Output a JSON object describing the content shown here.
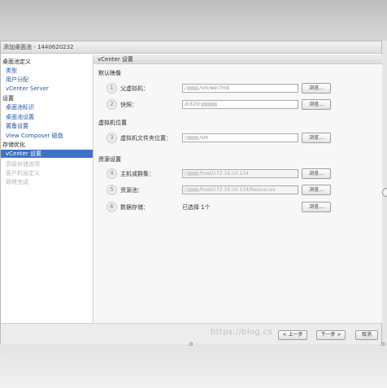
{
  "dialog": {
    "title": "添加桌面池 - 1440620232"
  },
  "sidebar": {
    "items": [
      {
        "label": "桌面池定义",
        "kind": "group"
      },
      {
        "label": "类型",
        "kind": "link"
      },
      {
        "label": "用户分配",
        "kind": "link"
      },
      {
        "label": "vCenter Server",
        "kind": "link"
      },
      {
        "label": "设置",
        "kind": "group"
      },
      {
        "label": "桌面池标识",
        "kind": "link"
      },
      {
        "label": "桌面池设置",
        "kind": "link"
      },
      {
        "label": "置备设置",
        "kind": "link"
      },
      {
        "label": "View Composer 磁盘",
        "kind": "link"
      },
      {
        "label": "存储优化",
        "kind": "group"
      },
      {
        "label": "vCenter 设置",
        "kind": "active"
      },
      {
        "label": "高级存储选项",
        "kind": "disabled"
      },
      {
        "label": "客户机自定义",
        "kind": "disabled"
      },
      {
        "label": "即将完成",
        "kind": "disabled"
      }
    ]
  },
  "content": {
    "header": "vCenter 设置",
    "sections": {
      "default_image": "默认映像",
      "vm_location": "虚拟机位置",
      "resource_settings": "资源设置"
    },
    "rows": [
      {
        "step": "1",
        "label": "父虚拟机：",
        "prefix": "/",
        "value": "/vm/win7mb",
        "disabled": false
      },
      {
        "step": "2",
        "label": "快照：",
        "prefix": "/0320/",
        "value": "",
        "disabled": false
      },
      {
        "step": "3",
        "label": "虚拟机文件夹位置：",
        "prefix": "/",
        "value": "/vm",
        "disabled": false
      },
      {
        "step": "4",
        "label": "主机或群集：",
        "prefix": "/",
        "value": "/host/172.16.10.134",
        "disabled": true
      },
      {
        "step": "5",
        "label": "资源池：",
        "prefix": "/",
        "value": "/host/172.16.10.134/Resources",
        "disabled": true
      },
      {
        "step": "6",
        "label": "数据存储：",
        "prefix": "",
        "value": "已选择 1个",
        "disabled": false
      }
    ],
    "browse_label": "浏览..."
  },
  "footer": {
    "watermark": "https://blog.cs",
    "back_label": "< 上一步",
    "next_label": "下一步 >",
    "cancel_label": "取消"
  },
  "colors": {
    "active_nav": "#3c73c4",
    "link": "#1f57a8"
  }
}
